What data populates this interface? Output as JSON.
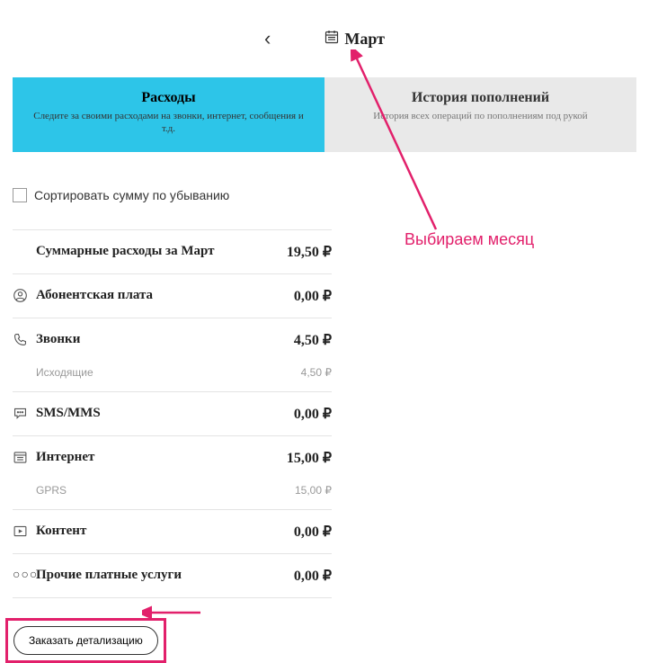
{
  "month_selector": {
    "month": "Март"
  },
  "tabs": {
    "expenses": {
      "title": "Расходы",
      "subtitle": "Следите за своими расходами на звонки,\nинтернет, сообщения и т.д."
    },
    "topups": {
      "title": "История пополнений",
      "subtitle": "История всех операций по пополнениям\nпод рукой"
    }
  },
  "sort": {
    "label": "Сортировать сумму по убыванию"
  },
  "rows": {
    "summary": {
      "label": "Суммарные расходы за Март",
      "value": "19,50 ₽"
    },
    "subscription": {
      "label": "Абонентская плата",
      "value": "0,00 ₽"
    },
    "calls": {
      "label": "Звонки",
      "value": "4,50 ₽",
      "sub_label": "Исходящие",
      "sub_value": "4,50 ₽"
    },
    "sms": {
      "label": "SMS/MMS",
      "value": "0,00 ₽"
    },
    "internet": {
      "label": "Интернет",
      "value": "15,00 ₽",
      "sub_label": "GPRS",
      "sub_value": "15,00 ₽"
    },
    "content": {
      "label": "Контент",
      "value": "0,00 ₽"
    },
    "other": {
      "label": "Прочие платные услуги",
      "value": "0,00 ₽"
    }
  },
  "order_button": "Заказать детализацию",
  "annotation": "Выбираем месяц"
}
